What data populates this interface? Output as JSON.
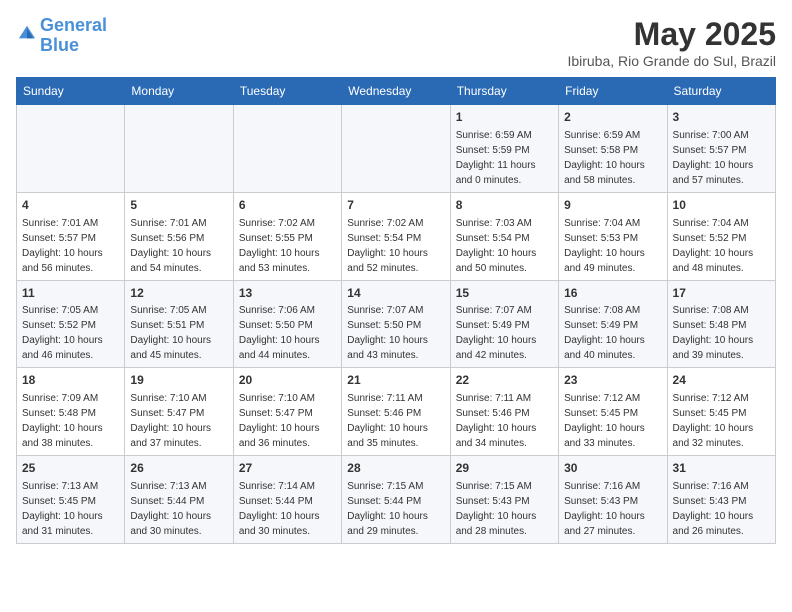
{
  "logo": {
    "line1": "General",
    "line2": "Blue"
  },
  "title": "May 2025",
  "location": "Ibiruba, Rio Grande do Sul, Brazil",
  "days_of_week": [
    "Sunday",
    "Monday",
    "Tuesday",
    "Wednesday",
    "Thursday",
    "Friday",
    "Saturday"
  ],
  "weeks": [
    [
      {
        "day": "",
        "info": ""
      },
      {
        "day": "",
        "info": ""
      },
      {
        "day": "",
        "info": ""
      },
      {
        "day": "",
        "info": ""
      },
      {
        "day": "1",
        "info": "Sunrise: 6:59 AM\nSunset: 5:59 PM\nDaylight: 11 hours\nand 0 minutes."
      },
      {
        "day": "2",
        "info": "Sunrise: 6:59 AM\nSunset: 5:58 PM\nDaylight: 10 hours\nand 58 minutes."
      },
      {
        "day": "3",
        "info": "Sunrise: 7:00 AM\nSunset: 5:57 PM\nDaylight: 10 hours\nand 57 minutes."
      }
    ],
    [
      {
        "day": "4",
        "info": "Sunrise: 7:01 AM\nSunset: 5:57 PM\nDaylight: 10 hours\nand 56 minutes."
      },
      {
        "day": "5",
        "info": "Sunrise: 7:01 AM\nSunset: 5:56 PM\nDaylight: 10 hours\nand 54 minutes."
      },
      {
        "day": "6",
        "info": "Sunrise: 7:02 AM\nSunset: 5:55 PM\nDaylight: 10 hours\nand 53 minutes."
      },
      {
        "day": "7",
        "info": "Sunrise: 7:02 AM\nSunset: 5:54 PM\nDaylight: 10 hours\nand 52 minutes."
      },
      {
        "day": "8",
        "info": "Sunrise: 7:03 AM\nSunset: 5:54 PM\nDaylight: 10 hours\nand 50 minutes."
      },
      {
        "day": "9",
        "info": "Sunrise: 7:04 AM\nSunset: 5:53 PM\nDaylight: 10 hours\nand 49 minutes."
      },
      {
        "day": "10",
        "info": "Sunrise: 7:04 AM\nSunset: 5:52 PM\nDaylight: 10 hours\nand 48 minutes."
      }
    ],
    [
      {
        "day": "11",
        "info": "Sunrise: 7:05 AM\nSunset: 5:52 PM\nDaylight: 10 hours\nand 46 minutes."
      },
      {
        "day": "12",
        "info": "Sunrise: 7:05 AM\nSunset: 5:51 PM\nDaylight: 10 hours\nand 45 minutes."
      },
      {
        "day": "13",
        "info": "Sunrise: 7:06 AM\nSunset: 5:50 PM\nDaylight: 10 hours\nand 44 minutes."
      },
      {
        "day": "14",
        "info": "Sunrise: 7:07 AM\nSunset: 5:50 PM\nDaylight: 10 hours\nand 43 minutes."
      },
      {
        "day": "15",
        "info": "Sunrise: 7:07 AM\nSunset: 5:49 PM\nDaylight: 10 hours\nand 42 minutes."
      },
      {
        "day": "16",
        "info": "Sunrise: 7:08 AM\nSunset: 5:49 PM\nDaylight: 10 hours\nand 40 minutes."
      },
      {
        "day": "17",
        "info": "Sunrise: 7:08 AM\nSunset: 5:48 PM\nDaylight: 10 hours\nand 39 minutes."
      }
    ],
    [
      {
        "day": "18",
        "info": "Sunrise: 7:09 AM\nSunset: 5:48 PM\nDaylight: 10 hours\nand 38 minutes."
      },
      {
        "day": "19",
        "info": "Sunrise: 7:10 AM\nSunset: 5:47 PM\nDaylight: 10 hours\nand 37 minutes."
      },
      {
        "day": "20",
        "info": "Sunrise: 7:10 AM\nSunset: 5:47 PM\nDaylight: 10 hours\nand 36 minutes."
      },
      {
        "day": "21",
        "info": "Sunrise: 7:11 AM\nSunset: 5:46 PM\nDaylight: 10 hours\nand 35 minutes."
      },
      {
        "day": "22",
        "info": "Sunrise: 7:11 AM\nSunset: 5:46 PM\nDaylight: 10 hours\nand 34 minutes."
      },
      {
        "day": "23",
        "info": "Sunrise: 7:12 AM\nSunset: 5:45 PM\nDaylight: 10 hours\nand 33 minutes."
      },
      {
        "day": "24",
        "info": "Sunrise: 7:12 AM\nSunset: 5:45 PM\nDaylight: 10 hours\nand 32 minutes."
      }
    ],
    [
      {
        "day": "25",
        "info": "Sunrise: 7:13 AM\nSunset: 5:45 PM\nDaylight: 10 hours\nand 31 minutes."
      },
      {
        "day": "26",
        "info": "Sunrise: 7:13 AM\nSunset: 5:44 PM\nDaylight: 10 hours\nand 30 minutes."
      },
      {
        "day": "27",
        "info": "Sunrise: 7:14 AM\nSunset: 5:44 PM\nDaylight: 10 hours\nand 30 minutes."
      },
      {
        "day": "28",
        "info": "Sunrise: 7:15 AM\nSunset: 5:44 PM\nDaylight: 10 hours\nand 29 minutes."
      },
      {
        "day": "29",
        "info": "Sunrise: 7:15 AM\nSunset: 5:43 PM\nDaylight: 10 hours\nand 28 minutes."
      },
      {
        "day": "30",
        "info": "Sunrise: 7:16 AM\nSunset: 5:43 PM\nDaylight: 10 hours\nand 27 minutes."
      },
      {
        "day": "31",
        "info": "Sunrise: 7:16 AM\nSunset: 5:43 PM\nDaylight: 10 hours\nand 26 minutes."
      }
    ]
  ]
}
